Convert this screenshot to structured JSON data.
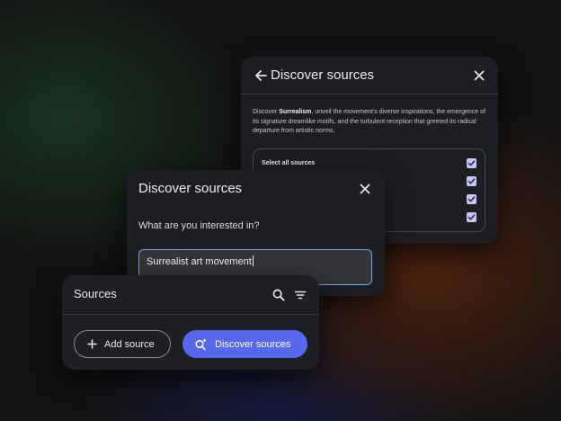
{
  "details_card": {
    "title": "Discover sources",
    "description_prefix": "Discover ",
    "description_topic": "Surrealism",
    "description_rest": ", unveil the movement's diverse inspirations, the emergence of its signature dreamlike motifs, and the turbulent reception that greeted its radical departure from artistic norms.",
    "select_all_label": "Select all sources",
    "checkbox_count": 4
  },
  "query_card": {
    "title": "Discover sources",
    "question": "What are you interested in?",
    "query_value": "Surrealist art movement"
  },
  "sources_card": {
    "title": "Sources",
    "add_source_label": "Add source",
    "discover_sources_label": "Discover sources"
  },
  "colors": {
    "accent_button": "#5768ec",
    "checkbox_fill": "#c8c5f3",
    "focus_border": "#7aa1e8"
  }
}
